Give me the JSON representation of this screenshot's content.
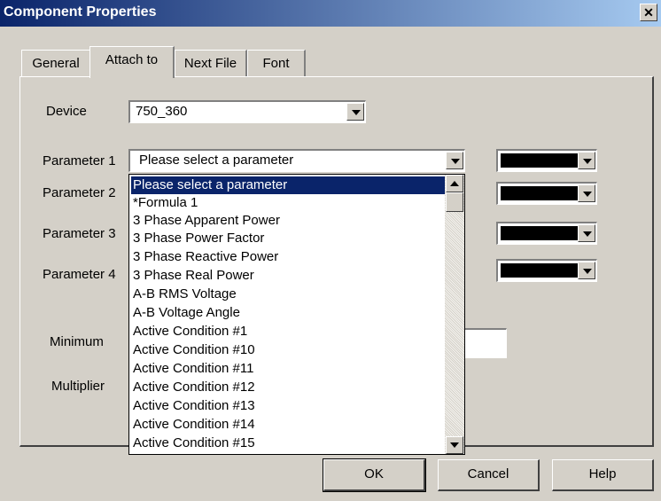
{
  "window": {
    "title": "Component Properties",
    "close_glyph": "✕"
  },
  "tabs": [
    {
      "label": "General"
    },
    {
      "label": "Attach to",
      "active": true
    },
    {
      "label": "Next File"
    },
    {
      "label": "Font"
    }
  ],
  "form": {
    "device_label": "Device",
    "device_value": "750_360",
    "param1_label": "Parameter 1",
    "param1_value": "Please select a parameter",
    "param2_label": "Parameter 2",
    "param3_label": "Parameter 3",
    "param4_label": "Parameter 4",
    "minimum_label": "Minimum",
    "multiplier_label": "Multiplier"
  },
  "dropdown_list": {
    "items": [
      "Please select a parameter",
      "*Formula 1",
      "3 Phase Apparent Power",
      "3 Phase Power Factor",
      "3 Phase Reactive Power",
      "3 Phase Real Power",
      "A-B RMS Voltage",
      "A-B Voltage Angle",
      "Active Condition #1",
      "Active Condition #10",
      "Active Condition #11",
      "Active Condition #12",
      "Active Condition #13",
      "Active Condition #14",
      "Active Condition #15"
    ],
    "selected_index": 0
  },
  "colors": {
    "swatch": "#000000",
    "selection": "#0a246a",
    "titlebar": "#0a246a"
  },
  "buttons": {
    "ok": "OK",
    "cancel": "Cancel",
    "help": "Help"
  }
}
